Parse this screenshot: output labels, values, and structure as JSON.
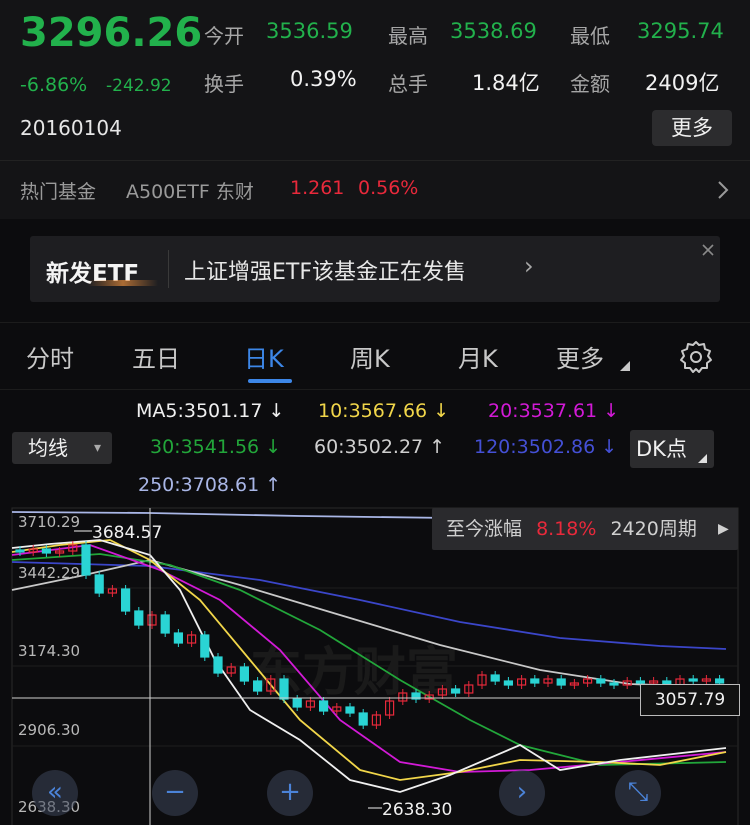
{
  "quote": {
    "price": "3296.26",
    "change_pct": "-6.86%",
    "change_amt": "-242.92",
    "open_label": "今开",
    "open_value": "3536.59",
    "high_label": "最高",
    "high_value": "3538.69",
    "low_label": "最低",
    "low_value": "3295.74",
    "turnover_label": "换手",
    "turnover_value": "0.39%",
    "volume_label": "总手",
    "volume_value": "1.84亿",
    "amount_label": "金额",
    "amount_value": "2409亿",
    "date": "20160104",
    "more_label": "更多"
  },
  "hot_fund": {
    "label": "热门基金",
    "name": "A500ETF 东财",
    "price": "1.261",
    "change": "0.56%",
    "chevron_icon": "chevron-right-icon"
  },
  "etf_banner": {
    "tag": "新发ETF",
    "text": "上证增强ETF该基金正在发售",
    "chevron": "›",
    "close_icon": "close-icon"
  },
  "tabs": [
    {
      "label": "分时"
    },
    {
      "label": "五日"
    },
    {
      "label": "日K",
      "active": true
    },
    {
      "label": "周K"
    },
    {
      "label": "月K"
    },
    {
      "label": "更多"
    }
  ],
  "settings_icon": "gear-icon",
  "ma_legend": {
    "ma5": "MA5:3501.17",
    "ma10": "10:3567.66",
    "ma20": "20:3537.61",
    "ma30": "30:3541.56",
    "ma60": "60:3502.27",
    "ma120": "120:3502.86",
    "ma250": "250:3708.61",
    "ma5_arrow": "↓",
    "ma10_arrow": "↓",
    "ma20_arrow": "↓",
    "ma30_arrow": "↓",
    "ma60_arrow": "↑",
    "ma120_arrow": "↓",
    "ma250_arrow": "↑",
    "colors": {
      "ma5": "#f0f0f0",
      "ma10": "#f1d64a",
      "ma20": "#d21ad6",
      "ma30": "#22a63a",
      "ma60": "#c8c8c8",
      "ma120": "#3b46c9",
      "ma250": "#a9b6e6"
    }
  },
  "indicator_select": {
    "label": "均线",
    "arrow": "▾"
  },
  "dk_button": {
    "label": "DK点"
  },
  "chart_data": {
    "type": "candlestick",
    "y_axis_ticks": [
      "3710.29",
      "3442.29",
      "3174.30",
      "2906.30",
      "2638.30"
    ],
    "high_marker": "3684.57",
    "low_marker": "2638.30",
    "crosshair_value": "3057.79",
    "since_label": "至今涨幅",
    "since_value": "8.18%",
    "since_periods": "2420周期",
    "watermark": "东方财富"
  },
  "controls": [
    {
      "name": "scroll-left-button",
      "glyph": "«"
    },
    {
      "name": "zoom-out-button",
      "glyph": "−"
    },
    {
      "name": "zoom-in-button",
      "glyph": "+"
    },
    {
      "name": "scroll-right-button",
      "glyph": "›"
    },
    {
      "name": "fullscreen-button",
      "glyph": "⤡"
    }
  ]
}
